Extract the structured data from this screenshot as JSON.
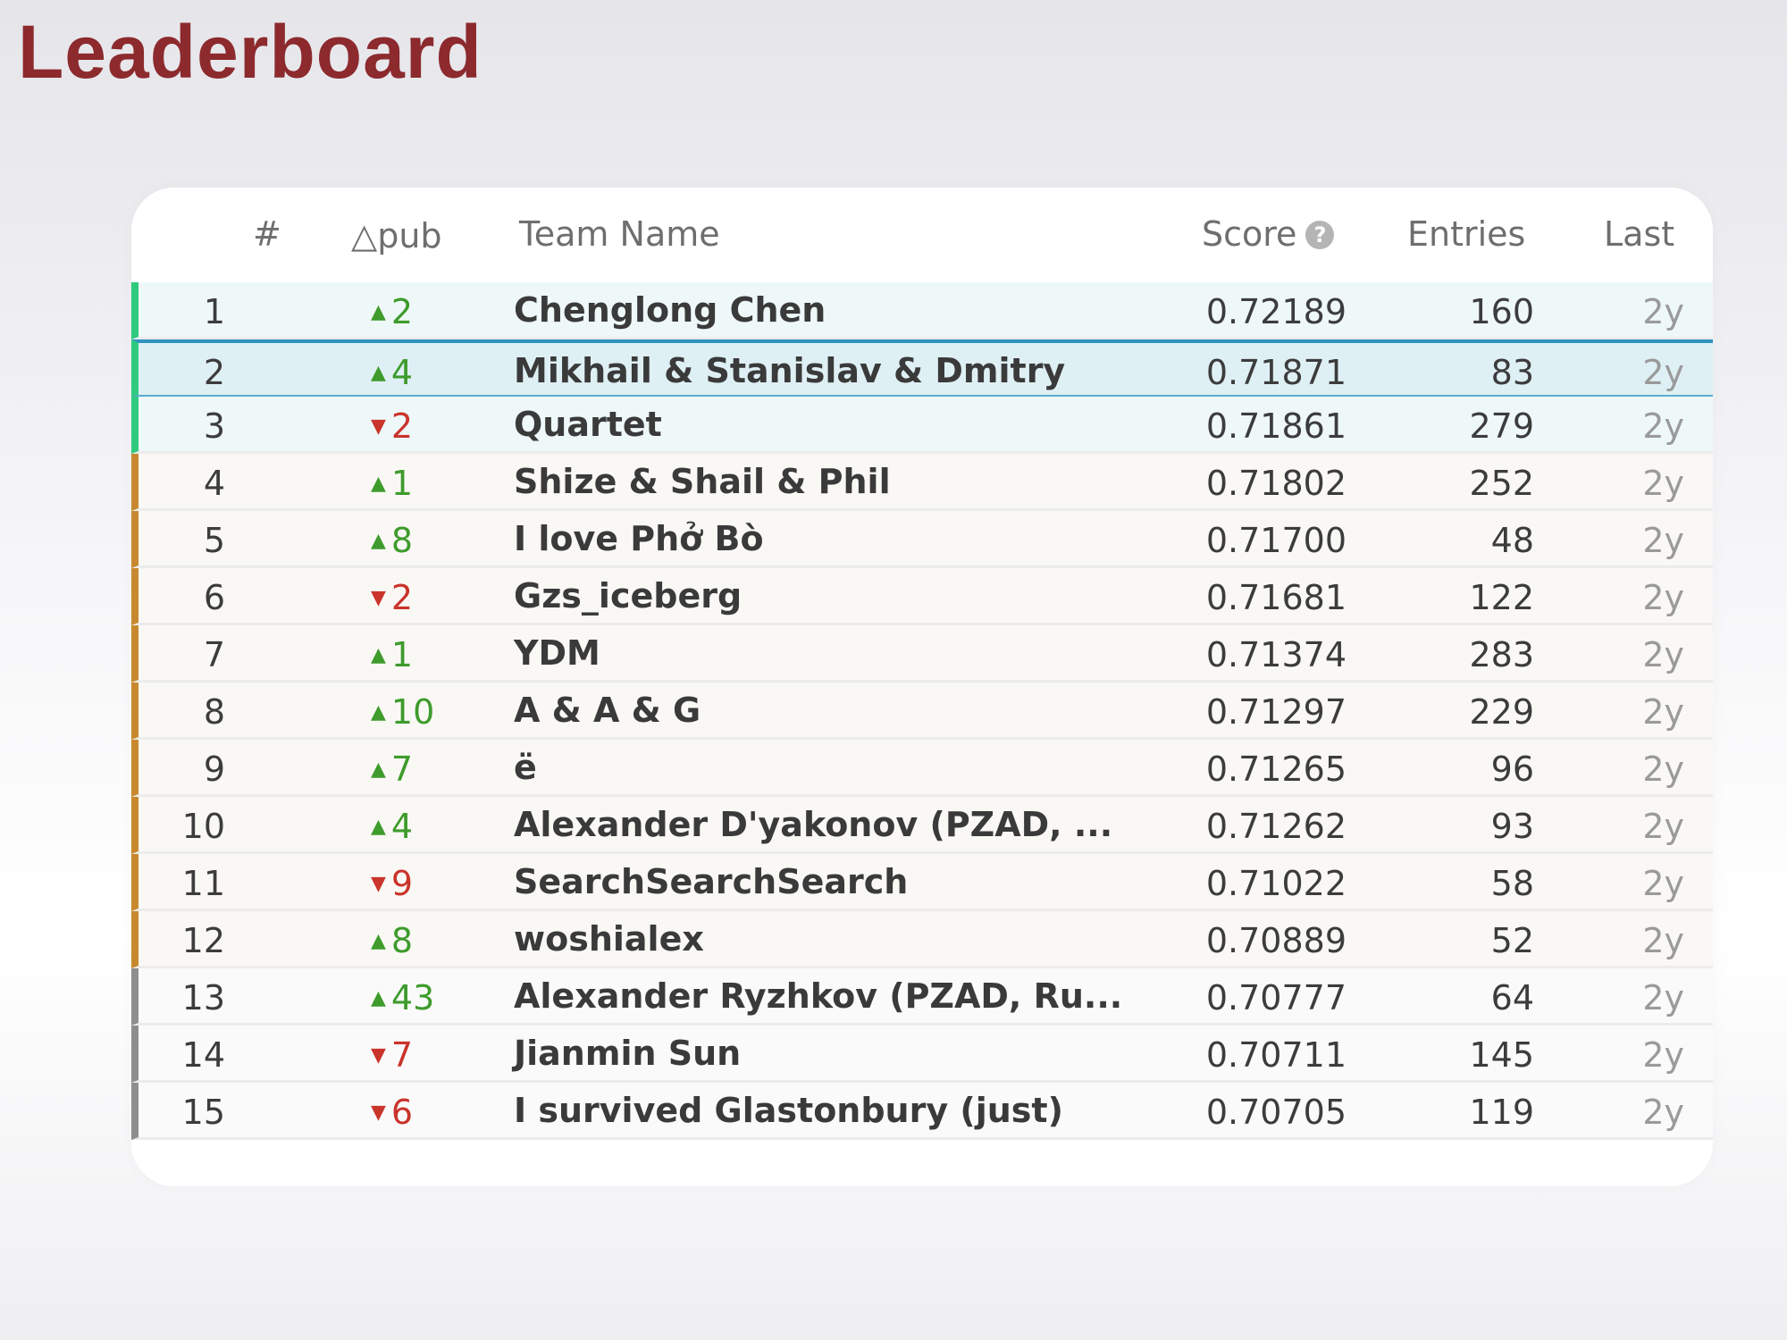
{
  "title": "Leaderboard",
  "header": {
    "rank": "#",
    "delta": "△pub",
    "team": "Team Name",
    "score": "Score",
    "help_icon": "?",
    "entries": "Entries",
    "last": "Last"
  },
  "colors": {
    "title": "#8c2a2e",
    "gold_marker": "#2fca7e",
    "silver_marker": "#c8892e",
    "bronze_marker": "#8e8e8e",
    "up": "#3e9b2c",
    "down": "#c9342b",
    "highlight": "#2f94c1"
  },
  "rows": [
    {
      "rank": "1",
      "dir": "up",
      "delta": "2",
      "team": "Chenglong Chen",
      "score": "0.72189",
      "entries": "160",
      "last": "2y",
      "tier": "gold"
    },
    {
      "rank": "2",
      "dir": "up",
      "delta": "4",
      "team": "Mikhail & Stanislav & Dmitry",
      "score": "0.71871",
      "entries": "83",
      "last": "2y",
      "tier": "gold",
      "highlighted": true
    },
    {
      "rank": "3",
      "dir": "down",
      "delta": "2",
      "team": "Quartet",
      "score": "0.71861",
      "entries": "279",
      "last": "2y",
      "tier": "gold"
    },
    {
      "rank": "4",
      "dir": "up",
      "delta": "1",
      "team": "Shize & Shail & Phil",
      "score": "0.71802",
      "entries": "252",
      "last": "2y",
      "tier": "silver"
    },
    {
      "rank": "5",
      "dir": "up",
      "delta": "8",
      "team": "I love Phở Bò",
      "score": "0.71700",
      "entries": "48",
      "last": "2y",
      "tier": "silver"
    },
    {
      "rank": "6",
      "dir": "down",
      "delta": "2",
      "team": "Gzs_iceberg",
      "score": "0.71681",
      "entries": "122",
      "last": "2y",
      "tier": "silver"
    },
    {
      "rank": "7",
      "dir": "up",
      "delta": "1",
      "team": "YDM",
      "score": "0.71374",
      "entries": "283",
      "last": "2y",
      "tier": "silver"
    },
    {
      "rank": "8",
      "dir": "up",
      "delta": "10",
      "team": "A & A & G",
      "score": "0.71297",
      "entries": "229",
      "last": "2y",
      "tier": "silver"
    },
    {
      "rank": "9",
      "dir": "up",
      "delta": "7",
      "team": "ë",
      "score": "0.71265",
      "entries": "96",
      "last": "2y",
      "tier": "silver"
    },
    {
      "rank": "10",
      "dir": "up",
      "delta": "4",
      "team": "Alexander D'yakonov (PZAD, ...",
      "score": "0.71262",
      "entries": "93",
      "last": "2y",
      "tier": "silver"
    },
    {
      "rank": "11",
      "dir": "down",
      "delta": "9",
      "team": "SearchSearchSearch",
      "score": "0.71022",
      "entries": "58",
      "last": "2y",
      "tier": "silver"
    },
    {
      "rank": "12",
      "dir": "up",
      "delta": "8",
      "team": "woshialex",
      "score": "0.70889",
      "entries": "52",
      "last": "2y",
      "tier": "silver"
    },
    {
      "rank": "13",
      "dir": "up",
      "delta": "43",
      "team": "Alexander Ryzhkov (PZAD, Ru...",
      "score": "0.70777",
      "entries": "64",
      "last": "2y",
      "tier": "bronze"
    },
    {
      "rank": "14",
      "dir": "down",
      "delta": "7",
      "team": "Jianmin Sun",
      "score": "0.70711",
      "entries": "145",
      "last": "2y",
      "tier": "bronze"
    },
    {
      "rank": "15",
      "dir": "down",
      "delta": "6",
      "team": "I survived Glastonbury (just)",
      "score": "0.70705",
      "entries": "119",
      "last": "2y",
      "tier": "bronze"
    }
  ]
}
